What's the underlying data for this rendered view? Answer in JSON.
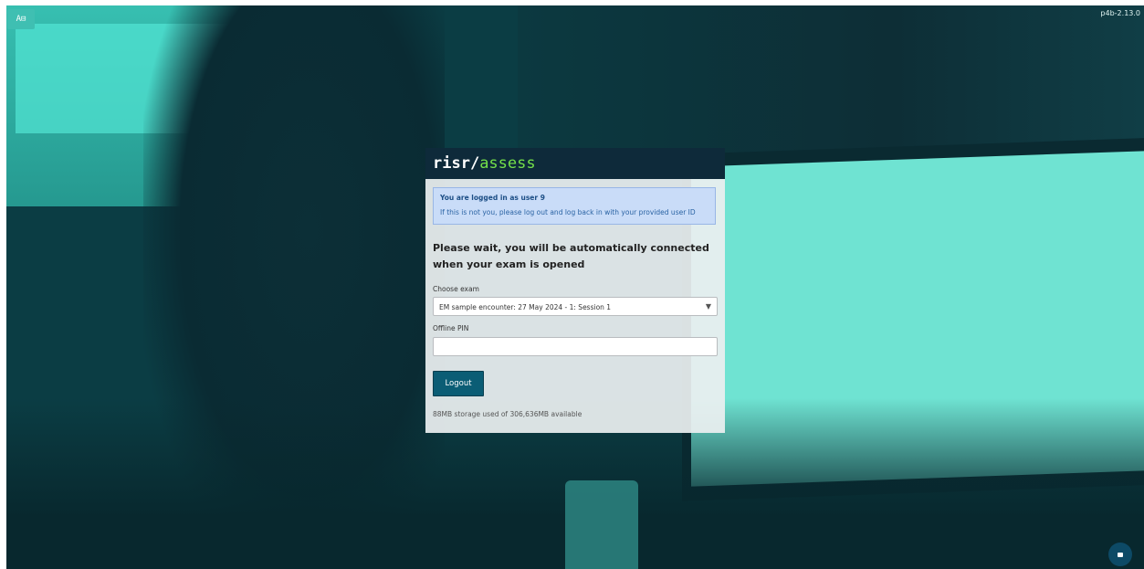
{
  "app": {
    "lang_badge": "A⊟",
    "version": "p4b-2.13.0"
  },
  "logo": {
    "part1": "risr/",
    "part2": "assess"
  },
  "alert": {
    "title": "You are logged in as user 9",
    "text": "If this is not you, please log out and log back in with your provided user ID"
  },
  "wait_message": "Please wait, you will be automatically connected when your exam is opened",
  "exam": {
    "label": "Choose exam",
    "selected": "EM sample encounter: 27 May 2024 - 1: Session 1",
    "arrow": "▼"
  },
  "pin": {
    "label": "Offline PIN",
    "value": ""
  },
  "logout_label": "Logout",
  "storage_text": "88MB storage used of 306,636MB available",
  "colors": {
    "header_bg": "#0e2a3a",
    "accent_green": "#74e04a",
    "button_bg": "#0b5d75",
    "alert_bg": "#c9dcf8"
  },
  "icons": {
    "lang": "language-toggle-icon",
    "chat": "chat-bubble-icon"
  }
}
